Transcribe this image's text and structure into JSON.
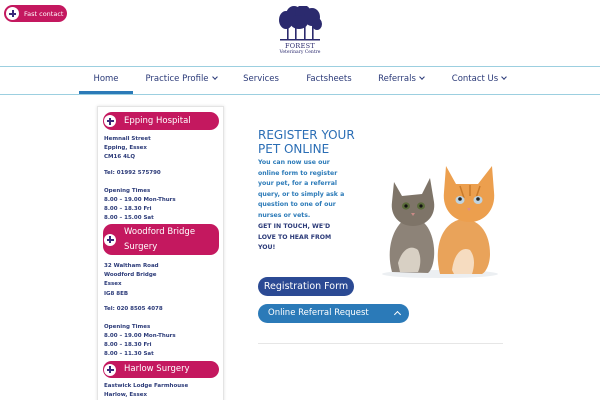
{
  "header": {
    "fast_contact": "Fast contact",
    "logo": {
      "name": "FOREST",
      "sub": "Veterinary Centre"
    }
  },
  "nav": {
    "items": [
      {
        "label": "Home",
        "active": true,
        "dropdown": false
      },
      {
        "label": "Practice Profile",
        "active": false,
        "dropdown": true
      },
      {
        "label": "Services",
        "active": false,
        "dropdown": false
      },
      {
        "label": "Factsheets",
        "active": false,
        "dropdown": false
      },
      {
        "label": "Referrals",
        "active": false,
        "dropdown": true
      },
      {
        "label": "Contact Us",
        "active": false,
        "dropdown": true
      }
    ]
  },
  "sidebar": {
    "locations": [
      {
        "name": "Epping Hospital",
        "address": "Hemnall Street\nEpping, Essex\nCM16 4LQ",
        "phone": "Tel: 01992 575790",
        "hours_title": "Opening Times",
        "hours": "8.00 – 19.00 Mon-Thurs\n8.00 – 18.30 Fri\n8.00 – 15.00 Sat"
      },
      {
        "name_line1": "Woodford Bridge",
        "name_line2": "Surgery",
        "address": "32 Waltham Road\nWoodford Bridge\nEssex\nIG8 8EB",
        "phone": "Tel: 020 8505 4078",
        "hours_title": "Opening Times",
        "hours": "8.00 – 19.00 Mon-Thurs\n8.00 – 18.30 Fri\n8.00 – 11.30 Sat"
      },
      {
        "name": "Harlow Surgery",
        "address": "Eastwick Lodge Farmhouse\nHarlow, Essex"
      }
    ]
  },
  "main": {
    "title_line1": "REGISTER YOUR",
    "title_line2": "PET ONLINE",
    "body": "You can now use our online form to register your pet, for a referral query, or to simply ask a question to one of our nurses or vets.",
    "cta": "GET IN TOUCH, WE'D LOVE TO HEAR FROM YOU!",
    "registration_button": "Registration Form",
    "referral_button": "Online Referral Request"
  },
  "colors": {
    "magenta": "#c4185f",
    "navy": "#2b3a78",
    "blue": "#2b7ab8",
    "button_navy": "#2b4a94",
    "nav_line": "#9ccfe0"
  },
  "icons": [
    "plus-icon",
    "chevron-down-icon",
    "chevron-up-icon",
    "forest-trees-logo"
  ]
}
